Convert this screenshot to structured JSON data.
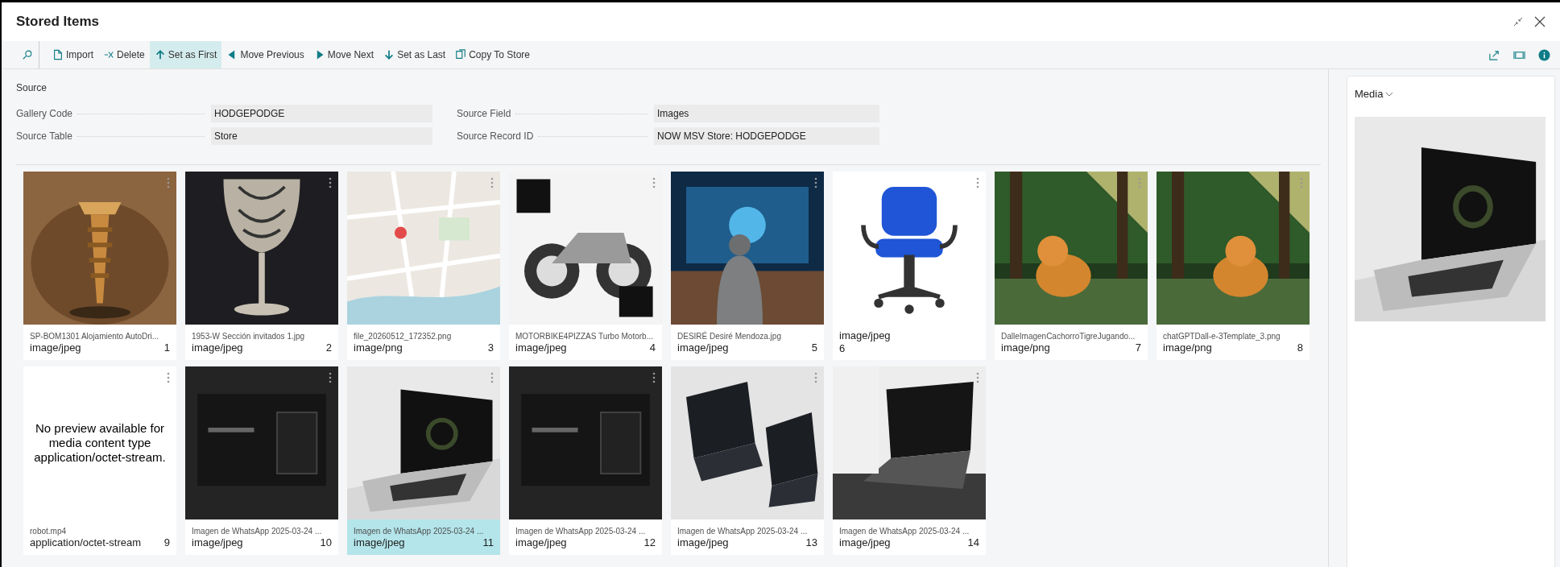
{
  "window": {
    "title": "Stored Items"
  },
  "toolbar": {
    "actions": [
      {
        "kind": "search",
        "hovered": false
      },
      {
        "kind": "import",
        "label": "Import",
        "hovered": false
      },
      {
        "kind": "delete",
        "label": "Delete",
        "hovered": false
      },
      {
        "kind": "first",
        "label": "Set as First",
        "hovered": true
      },
      {
        "kind": "previous",
        "label": "Move Previous",
        "hovered": false
      },
      {
        "kind": "next",
        "label": "Move Next",
        "hovered": false
      },
      {
        "kind": "last",
        "label": "Set as Last",
        "hovered": false
      },
      {
        "kind": "copy",
        "label": "Copy To Store",
        "hovered": false
      }
    ]
  },
  "section": {
    "title": "Source",
    "fields": [
      {
        "label": "Gallery Code",
        "value": "HODGEPODGE"
      },
      {
        "label": "Source Field",
        "value": "Images"
      },
      {
        "label": "Source Table",
        "value": "Store"
      },
      {
        "label": "Source Record ID",
        "value": "NOW MSV Store: HODGEPODGE"
      }
    ]
  },
  "items": [
    {
      "kind": "picture",
      "file_name": "SP-BOM1301 Alojamiento AutoDri...",
      "content_type": "image/jpeg",
      "number": "1",
      "selected": false
    },
    {
      "kind": "picture",
      "file_name": "1953-W Sección invitados 1.jpg",
      "content_type": "image/jpeg",
      "number": "2",
      "selected": false
    },
    {
      "kind": "picture",
      "file_name": "file_20260512_172352.png",
      "content_type": "image/png",
      "number": "3",
      "selected": false
    },
    {
      "kind": "picture",
      "file_name": "MOTORBIKE4PIZZAS Turbo Motorb...",
      "content_type": "image/jpeg",
      "number": "4",
      "selected": false
    },
    {
      "kind": "picture",
      "file_name": "DESIRÉ Desiré Mendoza.jpg",
      "content_type": "image/jpeg",
      "number": "5",
      "selected": false
    },
    {
      "kind": "picture",
      "content_type": "image/jpeg",
      "number": "6",
      "selected": false
    },
    {
      "kind": "picture",
      "file_name": "DalleImagenCachorroTigreJugando...",
      "content_type": "image/png",
      "number": "7",
      "selected": false
    },
    {
      "kind": "picture",
      "file_name": "chatGPTDall-e-3Template_3.png",
      "content_type": "image/png",
      "number": "8",
      "selected": false
    },
    {
      "kind": "no_preview",
      "message": "No preview available for media content type application/octet-stream.",
      "file_name": "robot.mp4",
      "content_type": "application/octet-stream",
      "number": "9",
      "selected": false
    },
    {
      "kind": "picture",
      "file_name": "Imagen de WhatsApp 2025-03-24 ...",
      "content_type": "image/jpeg",
      "number": "10",
      "selected": false
    },
    {
      "kind": "picture",
      "file_name": "Imagen de WhatsApp 2025-03-24 ...",
      "content_type": "image/jpeg",
      "number": "11",
      "selected": true
    },
    {
      "kind": "picture",
      "file_name": "Imagen de WhatsApp 2025-03-24 ...",
      "content_type": "image/jpeg",
      "number": "12",
      "selected": false
    },
    {
      "kind": "picture",
      "file_name": "Imagen de WhatsApp 2025-03-24 ...",
      "content_type": "image/jpeg",
      "number": "13",
      "selected": false
    },
    {
      "kind": "picture",
      "file_name": "Imagen de WhatsApp 2025-03-24 ...",
      "content_type": "image/jpeg",
      "number": "14",
      "selected": false
    }
  ],
  "media_panel": {
    "title": "Media"
  }
}
